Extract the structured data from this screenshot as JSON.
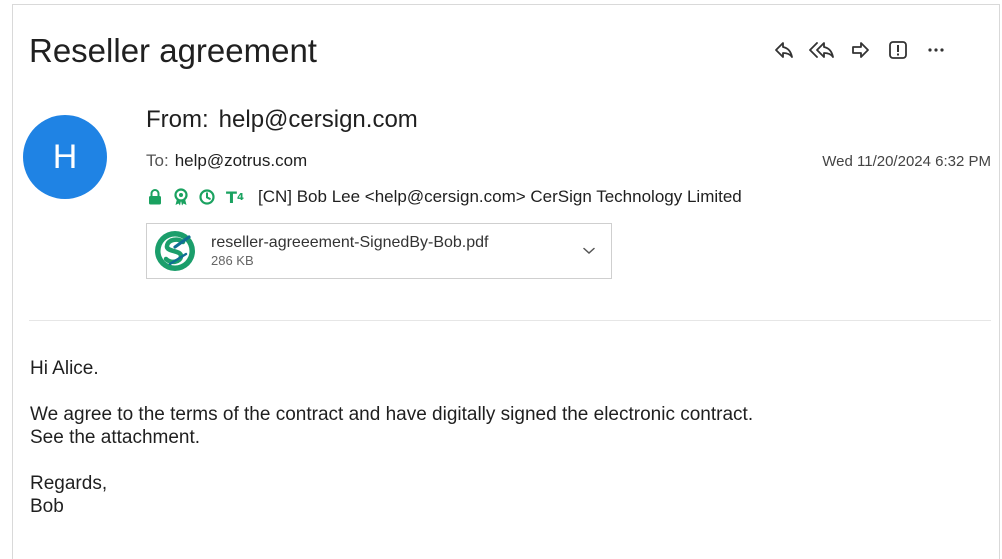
{
  "email": {
    "subject": "Reseller agreement",
    "avatar_initial": "H",
    "from_label": "From:",
    "from_address": "help@cersign.com",
    "to_label": "To:",
    "to_address": "help@zotrus.com",
    "date": "Wed 11/20/2024 6:32 PM",
    "certificate": {
      "icons": [
        "lock-icon",
        "certificate-badge-icon",
        "clock-icon",
        "t4-level-icon"
      ],
      "t4_label": "T",
      "t4_sub": "4",
      "text": "[CN] Bob Lee <help@cersign.com> CerSign Technology Limited",
      "icon_color": "#1aa260"
    },
    "attachment": {
      "name": "reseller-agreeement-SignedBy-Bob.pdf",
      "size": "286 KB",
      "icon": "cersign-pdf-icon"
    },
    "body": {
      "greeting": "Hi Alice.",
      "line1": "We agree to the terms of the contract and have digitally signed the electronic contract.",
      "line2": "See the attachment.",
      "closing": "Regards,",
      "signature": "Bob"
    }
  },
  "toolbar": {
    "actions": [
      "reply-icon",
      "reply-all-icon",
      "forward-icon",
      "report-icon",
      "more-icon"
    ],
    "more_label": "..."
  },
  "colors": {
    "avatar": "#1f83e4",
    "accent_green": "#1aa260"
  }
}
